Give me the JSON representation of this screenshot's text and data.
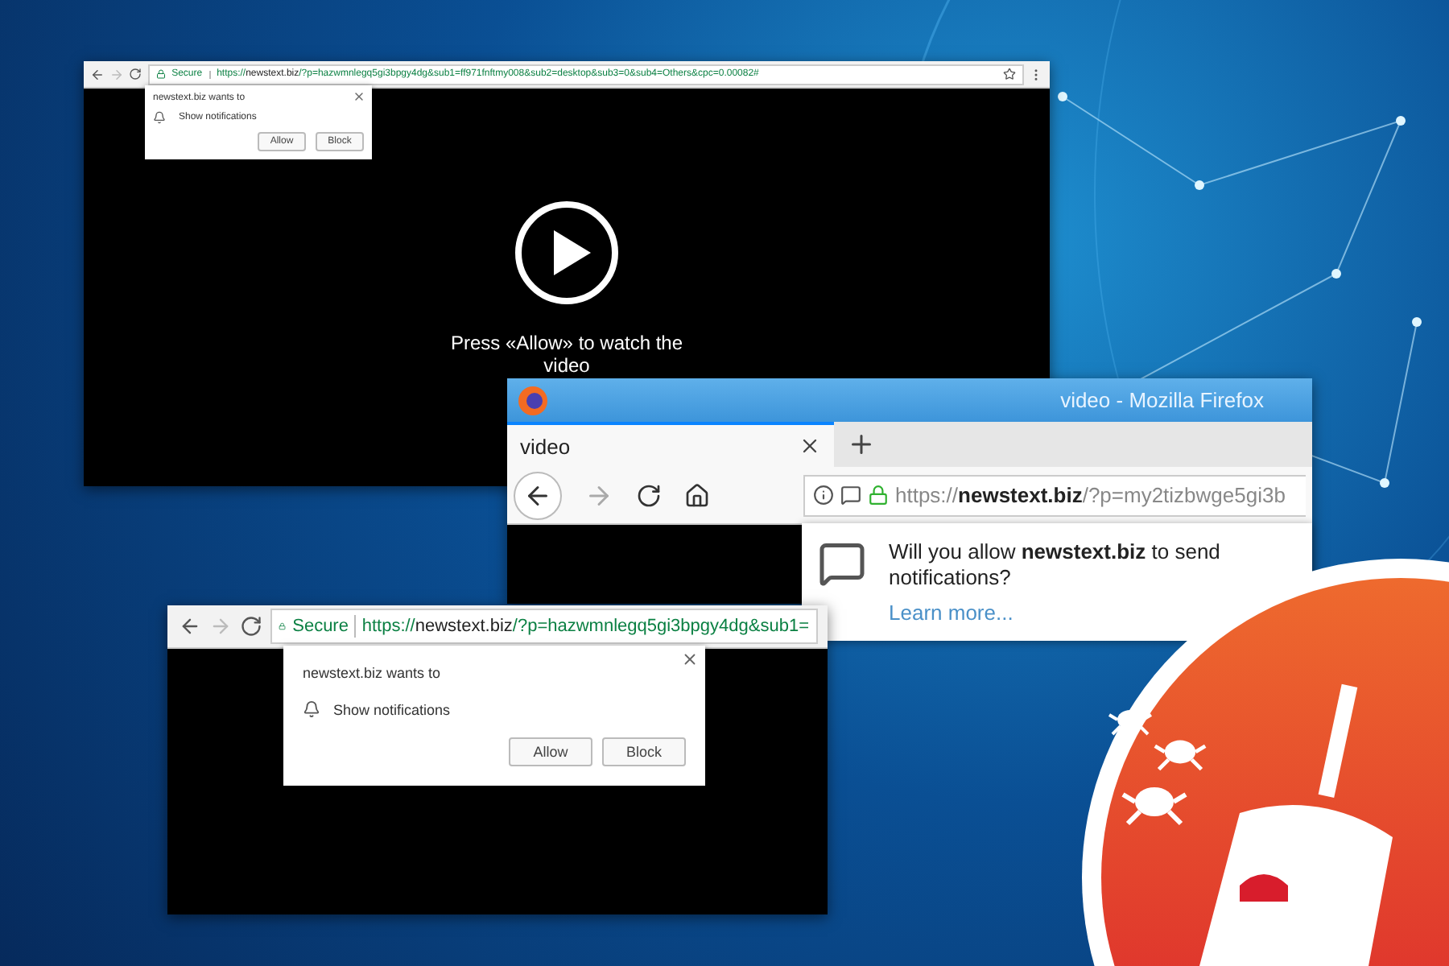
{
  "video_window": {
    "secure_label": "Secure",
    "url": "https://**newstext.biz**/?p=hazwmnlegq5gi3bpgy4dg&sub1=ff971fnftmy008&sub2=desktop&sub3=0&sub4=Others&cpc=0.00082#",
    "prompt": {
      "title": "newstext.biz wants to",
      "permission": "Show notifications",
      "buttons": [
        "Allow",
        "Block"
      ]
    },
    "caption": "Press «Allow» to watch the video"
  },
  "firefox_window": {
    "title": "video - Mozilla Firefox",
    "tab": {
      "label": "video",
      "selected": true
    },
    "url": "https://**newstext.biz**/?p=my2tizbwge5gi3b",
    "prompt": {
      "text": "Will you allow **newstext.biz** to send notifications?",
      "link": "Learn more..."
    }
  },
  "chrome_window": {
    "secure_label": "Secure",
    "url": "https://**newstext.biz**/?p=hazwmnlegq5gi3bpgy4dg&sub1=",
    "prompt": {
      "title": "newstext.biz wants to",
      "permission": "Show notifications",
      "buttons": [
        "Allow",
        "Block"
      ]
    }
  }
}
